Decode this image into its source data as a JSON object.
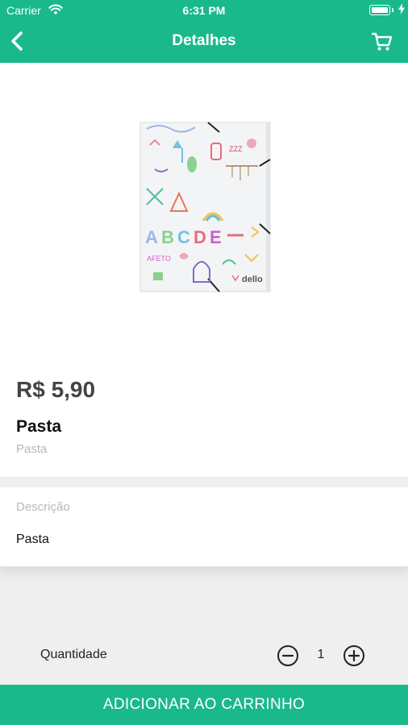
{
  "status_bar": {
    "carrier": "Carrier",
    "time": "6:31 PM"
  },
  "nav": {
    "title": "Detalhes",
    "back_icon": "chevron-left-icon",
    "cart_icon": "cart-icon"
  },
  "product": {
    "price": "R$ 5,90",
    "name": "Pasta",
    "category": "Pasta",
    "image_brand": "dello"
  },
  "description": {
    "label": "Descrição",
    "text": "Pasta"
  },
  "quantity": {
    "label": "Quantidade",
    "value": "1"
  },
  "add_button": {
    "label": "ADICIONAR AO CARRINHO"
  },
  "colors": {
    "accent": "#19b98b",
    "background": "#efefef",
    "card": "#ffffff",
    "muted_text": "#b8b8b8"
  }
}
